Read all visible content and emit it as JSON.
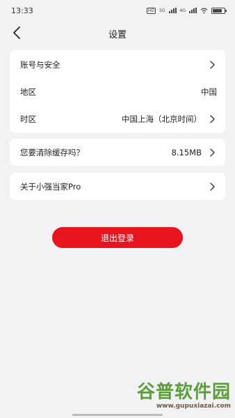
{
  "status_bar": {
    "time": "13:33",
    "network_1": "5G",
    "network_2": "4G"
  },
  "header": {
    "title": "设置"
  },
  "account_group": {
    "items": [
      {
        "label": "账号与安全",
        "value": ""
      },
      {
        "label": "地区",
        "value": "中国"
      },
      {
        "label": "时区",
        "value": "中国上海（北京时间）"
      }
    ]
  },
  "cache": {
    "label": "您要清除缓存吗？",
    "value": "8.15MB"
  },
  "about": {
    "label": "关于小强当家Pro"
  },
  "logout": {
    "label": "退出登录"
  },
  "watermark": {
    "name": "谷普软件园",
    "url": "www.gupuxiazai.com"
  },
  "colors": {
    "accent": "#e8141e",
    "background": "#f2f2f4",
    "card": "#ffffff"
  }
}
